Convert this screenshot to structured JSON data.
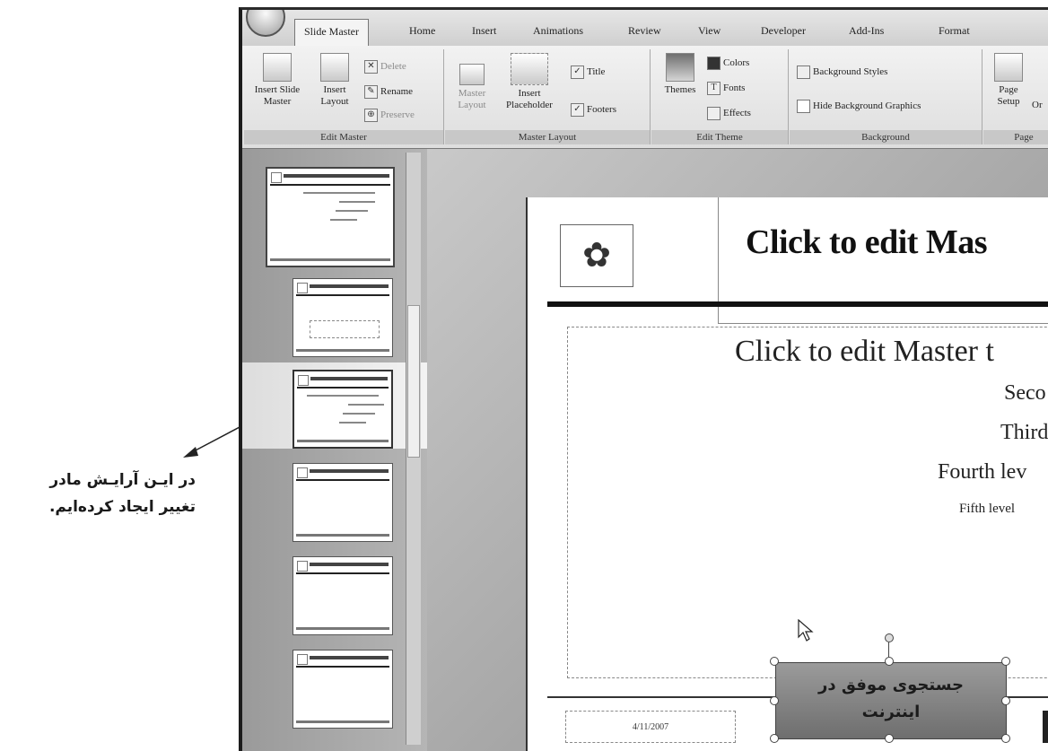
{
  "annotation": {
    "line1": "در ایـن آرایـش مادر",
    "line2": "تغییر ایجاد کرده‌ایم."
  },
  "ribbon": {
    "tabs": [
      {
        "label": "Slide Master",
        "active": true
      },
      {
        "label": "Home"
      },
      {
        "label": "Insert"
      },
      {
        "label": "Animations"
      },
      {
        "label": "Review"
      },
      {
        "label": "View"
      },
      {
        "label": "Developer"
      },
      {
        "label": "Add-Ins"
      },
      {
        "label": "Format"
      }
    ],
    "edit_master": {
      "group_label": "Edit Master",
      "insert_slide_master": "Insert Slide Master",
      "insert_layout": "Insert Layout",
      "delete": "Delete",
      "rename": "Rename",
      "preserve": "Preserve"
    },
    "master_layout": {
      "group_label": "Master Layout",
      "master_layout": "Master Layout",
      "insert_placeholder": "Insert Placeholder",
      "title": "Title",
      "footers": "Footers",
      "title_checked": true,
      "footers_checked": true
    },
    "edit_theme": {
      "group_label": "Edit Theme",
      "themes": "Themes",
      "colors": "Colors",
      "fonts": "Fonts",
      "effects": "Effects"
    },
    "background": {
      "group_label": "Background",
      "background_styles": "Background Styles",
      "hide_background_graphics": "Hide Background Graphics"
    },
    "page_setup": {
      "group_label": "Page",
      "page_setup": "Page Setup",
      "orientation_partial": "Or"
    }
  },
  "slide": {
    "title": "Click to edit Mas",
    "body_level1": "Click to edit Master t",
    "level2": "Seco",
    "level3": "Third",
    "level4": "Fourth lev",
    "level5": "Fifth level",
    "date": "4/11/2007",
    "footer_line1": "جستجوی موفق در",
    "footer_line2": "اینترنت"
  },
  "icons": {
    "logo": "flower-emblem-icon",
    "cursor": "mouse-pointer-icon"
  }
}
